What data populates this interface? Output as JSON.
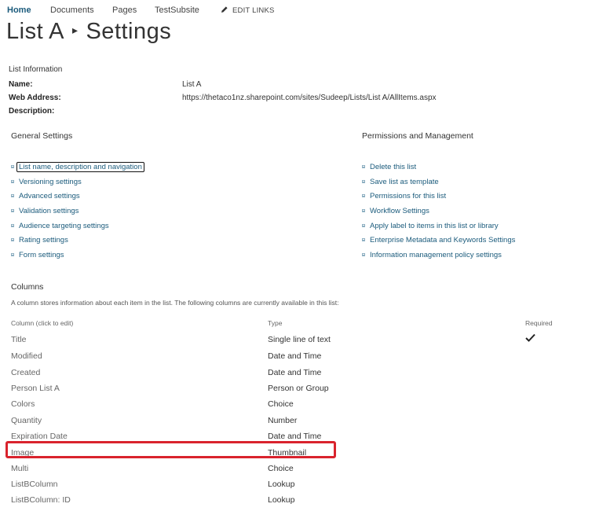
{
  "nav": {
    "items": [
      "Home",
      "Documents",
      "Pages",
      "TestSubsite"
    ],
    "edit_links": "EDIT LINKS"
  },
  "title": {
    "list": "List A",
    "sep": "▸",
    "page": "Settings"
  },
  "list_info": {
    "header": "List Information",
    "name_label": "Name:",
    "name_value": "List A",
    "web_label": "Web Address:",
    "web_value": "https://thetaco1nz.sharepoint.com/sites/Sudeep/Lists/List A/AllItems.aspx",
    "desc_label": "Description:"
  },
  "general": {
    "header": "General Settings",
    "links": [
      "List name, description and navigation",
      "Versioning settings",
      "Advanced settings",
      "Validation settings",
      "Audience targeting settings",
      "Rating settings",
      "Form settings"
    ]
  },
  "permissions": {
    "header": "Permissions and Management",
    "links": [
      "Delete this list",
      "Save list as template",
      "Permissions for this list",
      "Workflow Settings",
      "Apply label to items in this list or library",
      "Enterprise Metadata and Keywords Settings",
      "Information management policy settings"
    ]
  },
  "columns": {
    "header": "Columns",
    "description": "A column stores information about each item in the list. The following columns are currently available in this list:",
    "col_header_name": "Column (click to edit)",
    "col_header_type": "Type",
    "col_header_required": "Required",
    "rows": [
      {
        "name": "Title",
        "type": "Single line of text",
        "required": true
      },
      {
        "name": "Modified",
        "type": "Date and Time",
        "required": false
      },
      {
        "name": "Created",
        "type": "Date and Time",
        "required": false
      },
      {
        "name": "Person List A",
        "type": "Person or Group",
        "required": false
      },
      {
        "name": "Colors",
        "type": "Choice",
        "required": false
      },
      {
        "name": "Quantity",
        "type": "Number",
        "required": false
      },
      {
        "name": "Expiration Date",
        "type": "Date and Time",
        "required": false
      },
      {
        "name": "Image",
        "type": "Thumbnail",
        "required": false
      },
      {
        "name": "Multi",
        "type": "Choice",
        "required": false
      },
      {
        "name": "ListBColumn",
        "type": "Lookup",
        "required": false
      },
      {
        "name": "ListBColumn: ID",
        "type": "Lookup",
        "required": false
      }
    ]
  },
  "colors": {
    "link": "#1b5b7c",
    "highlight": "#d9232d",
    "text": "#333333",
    "muted": "#666666"
  }
}
